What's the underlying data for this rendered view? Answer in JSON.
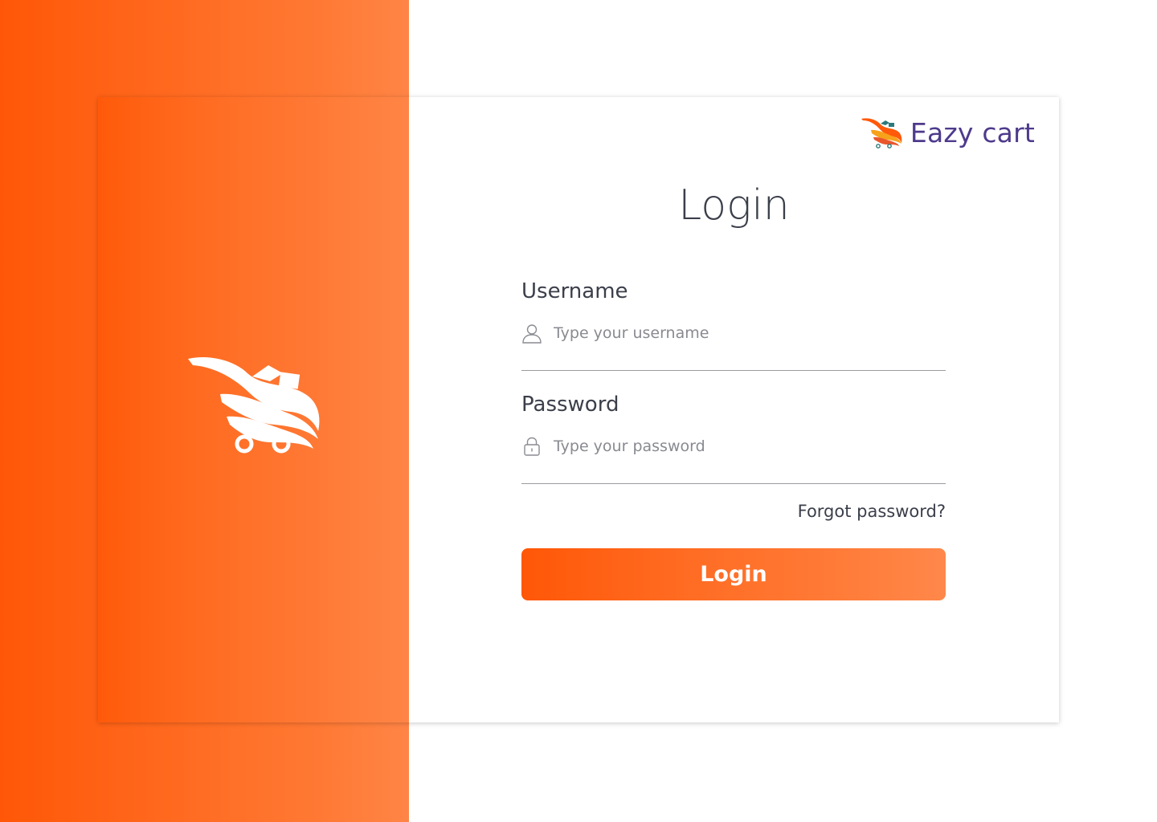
{
  "brand": {
    "name": "Eazy cart",
    "name_color": "#4e3a8c"
  },
  "login": {
    "title": "Login",
    "username": {
      "label": "Username",
      "placeholder": "Type your username",
      "icon": "user-icon"
    },
    "password": {
      "label": "Password",
      "placeholder": "Type your password",
      "icon": "lock-icon"
    },
    "forgot_label": "Forgot password?",
    "submit_label": "Login"
  },
  "colors": {
    "accent_start": "#ff5707",
    "accent_end": "#ff884a",
    "text": "#3b3f4a"
  }
}
